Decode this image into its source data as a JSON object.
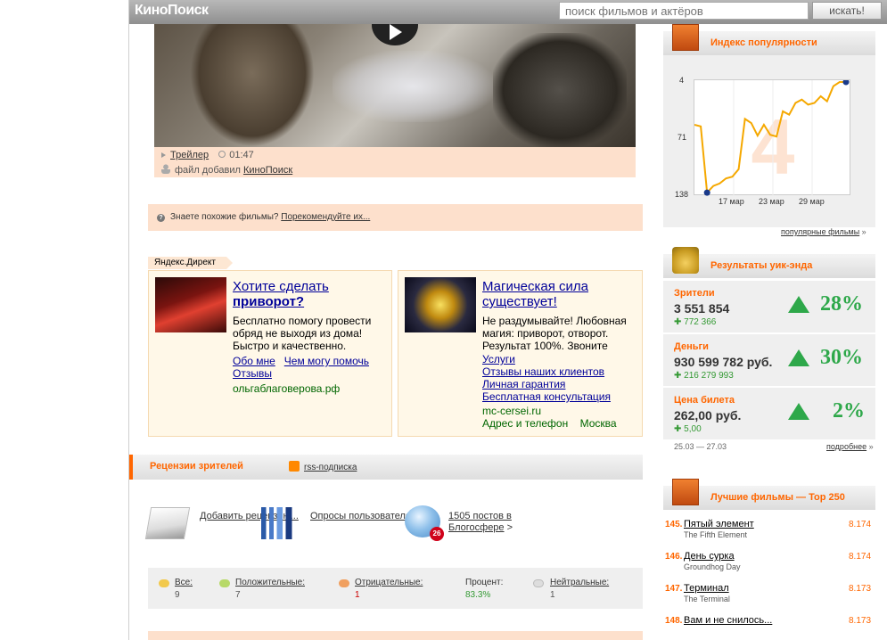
{
  "header": {
    "logo": "КиноПоиск",
    "search_placeholder": "поиск фильмов и актёров",
    "search_button": "искать!"
  },
  "trailer": {
    "type_label": "Трейлер",
    "duration": "01:47",
    "added_by_prefix": "файл добавил",
    "added_by": "КиноПоиск"
  },
  "similar": {
    "question": "Знаете похожие фильмы?",
    "link": "Порекомендуйте их..."
  },
  "direct": {
    "label": "Яндекс.Директ",
    "ads": [
      {
        "title_plain": "Хотите сделать",
        "title_bold": "приворот?",
        "text": "Бесплатно помогу провести обряд не выходя из дома! Быстро и качественно.",
        "links": [
          "Обо мне",
          "Чем могу помочь",
          "Отзывы"
        ],
        "domain": "ольгаблаговерова.рф"
      },
      {
        "title_plain": "Магическая сила существует!",
        "text": "Не раздумывайте! Любовная магия: приворот, отворот. Результат 100%. Звоните",
        "links": [
          "Услуги",
          "Отзывы наших клиентов",
          "Личная гарантия",
          "Бесплатная консультация"
        ],
        "domain": "mc-cersei.ru",
        "extra_1": "Адрес и телефон",
        "extra_2": "Москва"
      }
    ]
  },
  "reviews": {
    "title": "Рецензии зрителей",
    "rss": "rss-подписка",
    "add_review": "Добавить рецензию...",
    "polls": "Опросы пользователей",
    "blogs": "1505 постов в Блогосфере",
    "blog_badge": "26",
    "stats": {
      "all_label": "Все:",
      "all_val": "9",
      "pos_label": "Положительные:",
      "pos_val": "7",
      "neg_label": "Отрицательные:",
      "neg_val": "1",
      "pct_label": "Процент:",
      "pct_val": "83.3%",
      "neu_label": "Нейтральные:",
      "neu_val": "1"
    }
  },
  "popularity": {
    "title": "Индекс популярности",
    "link": "популярные фильмы",
    "big_number": "4",
    "y_ticks": [
      "4",
      "71",
      "138"
    ],
    "x_ticks": [
      "17 мар",
      "23 мар",
      "29 мар"
    ]
  },
  "chart_data": {
    "type": "line",
    "title": "Индекс популярности",
    "ylim": [
      138,
      4
    ],
    "y_inverted": true,
    "series": [
      {
        "values": [
          55,
          57,
          136,
          128,
          125,
          119,
          117,
          108,
          48,
          53,
          68,
          55,
          67,
          69,
          39,
          43,
          29,
          25,
          31,
          29,
          21,
          27,
          9,
          4,
          4
        ]
      }
    ]
  },
  "weekend": {
    "title": "Результаты уик-энда",
    "rows": [
      {
        "label": "Зрители",
        "value": "3 551 854",
        "delta": "772 366",
        "pct": "28%"
      },
      {
        "label": "Деньги",
        "value": "930 599 782 руб.",
        "delta": "216 279 993",
        "pct": "30%"
      },
      {
        "label": "Цена билета",
        "value": "262,00 руб.",
        "delta": "5,00",
        "pct": "2%"
      }
    ],
    "period": "25.03 — 27.03",
    "more": "подробнее"
  },
  "top250": {
    "title": "Лучшие фильмы — Top 250",
    "items": [
      {
        "num": "145.",
        "ru": "Пятый элемент",
        "en": "The Fifth Element",
        "rating": "8.174"
      },
      {
        "num": "146.",
        "ru": "День сурка",
        "en": "Groundhog Day",
        "rating": "8.174"
      },
      {
        "num": "147.",
        "ru": "Терминал",
        "en": "The Terminal",
        "rating": "8.173"
      },
      {
        "num": "148.",
        "ru": "Вам и не снилось...",
        "en": "",
        "rating": "8.173"
      }
    ]
  },
  "colors": {
    "accent": "#ff6600",
    "peach": "#fde0cc",
    "ad_link": "#000099",
    "up_green": "#2ea84a"
  }
}
